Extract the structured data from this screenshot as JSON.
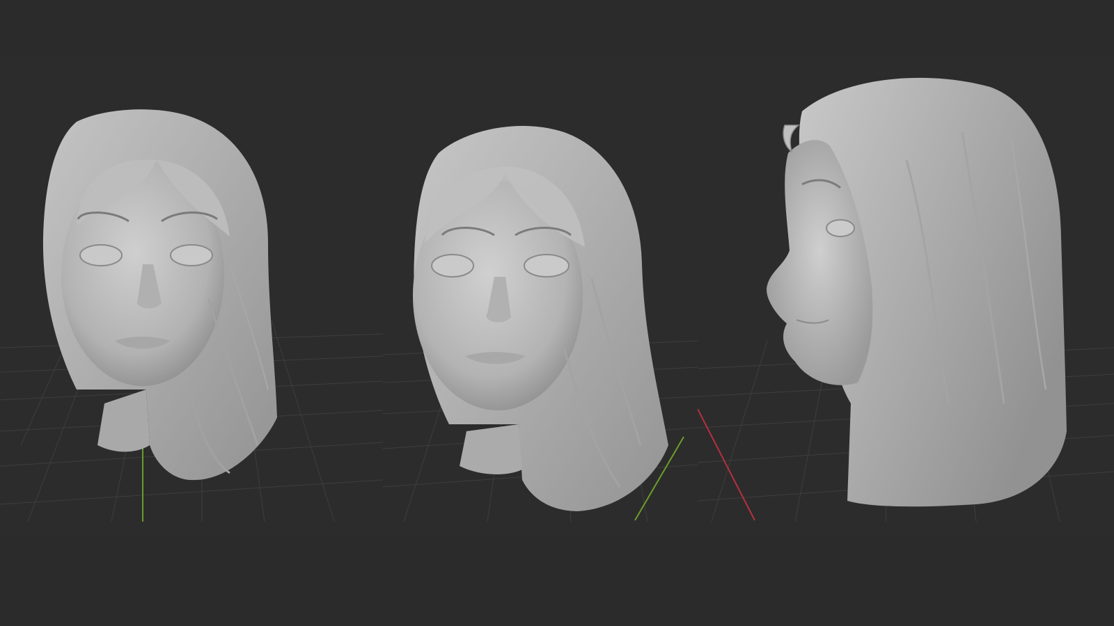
{
  "scene": {
    "views": [
      {
        "id": "front",
        "axis_line": "y-axis",
        "axis_color": "#6c9d2b"
      },
      {
        "id": "three-quarter",
        "axis_line": "y-axis",
        "axis_color": "#6c9d2b"
      },
      {
        "id": "side",
        "axis_line": "x-axis",
        "axis_color": "#b53040"
      }
    ],
    "colors": {
      "background": "#2b2b2b",
      "grid": "#3f3f3f",
      "clay": "#bdbdbd",
      "clay_shadow": "#8f8f8f"
    }
  }
}
